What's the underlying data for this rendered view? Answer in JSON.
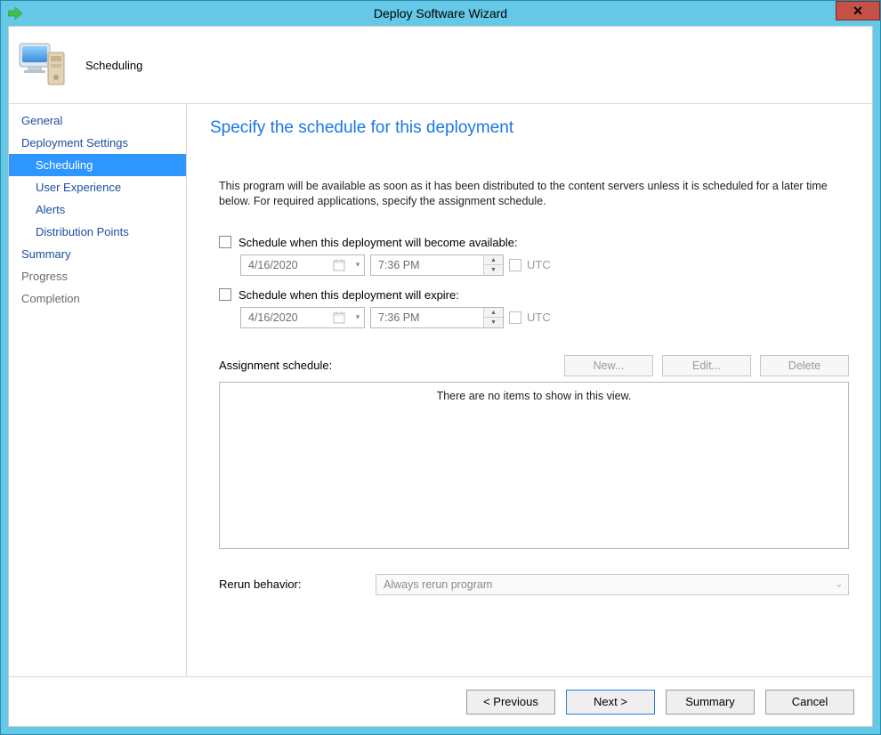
{
  "title": "Deploy Software Wizard",
  "header": {
    "label": "Scheduling"
  },
  "sidebar": {
    "items": [
      {
        "label": "General",
        "kind": "link"
      },
      {
        "label": "Deployment Settings",
        "kind": "link"
      },
      {
        "label": "Scheduling",
        "kind": "selected",
        "sub": true
      },
      {
        "label": "User Experience",
        "kind": "link",
        "sub": true
      },
      {
        "label": "Alerts",
        "kind": "link",
        "sub": true
      },
      {
        "label": "Distribution Points",
        "kind": "link",
        "sub": true
      },
      {
        "label": "Summary",
        "kind": "link"
      },
      {
        "label": "Progress",
        "kind": "disabled"
      },
      {
        "label": "Completion",
        "kind": "disabled"
      }
    ]
  },
  "main": {
    "heading": "Specify the schedule for this deployment",
    "intro": "This program will be available as soon as it has been distributed to the content servers unless it is scheduled for a later time below. For required applications, specify the assignment schedule.",
    "chk_available_label": "Schedule when this deployment will become available:",
    "chk_expire_label": "Schedule when this deployment will expire:",
    "available": {
      "date": "4/16/2020",
      "time": "7:36 PM",
      "utc_label": "UTC"
    },
    "expire": {
      "date": "4/16/2020",
      "time": "7:36 PM",
      "utc_label": "UTC"
    },
    "assignment_label": "Assignment schedule:",
    "btn_new": "New...",
    "btn_edit": "Edit...",
    "btn_delete": "Delete",
    "list_empty": "There are no items to show in this view.",
    "rerun_label": "Rerun behavior:",
    "rerun_value": "Always rerun program"
  },
  "footer": {
    "prev": "< Previous",
    "next": "Next >",
    "summary": "Summary",
    "cancel": "Cancel"
  }
}
